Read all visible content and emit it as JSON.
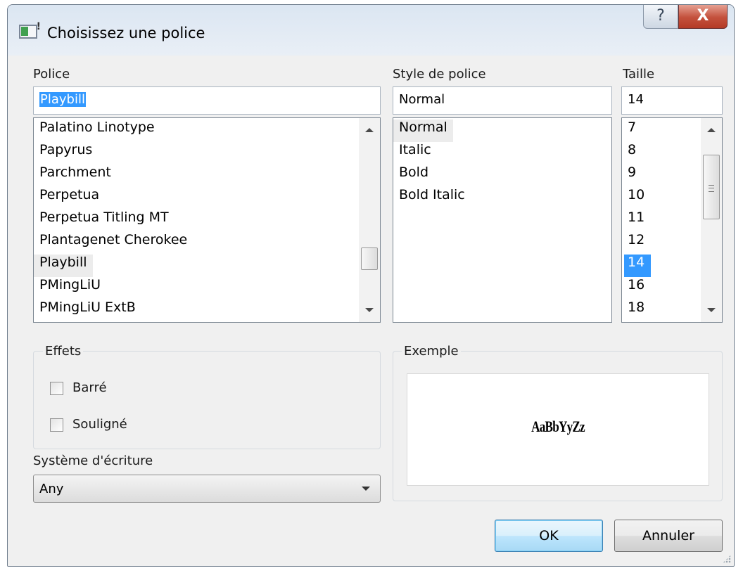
{
  "window": {
    "title": "Choisissez une police",
    "help_label": "?",
    "close_label": "X"
  },
  "font": {
    "label": "Police",
    "value": "Playbill",
    "items": [
      "Palatino Linotype",
      "Papyrus",
      "Parchment",
      "Perpetua",
      "Perpetua Titling MT",
      "Plantagenet Cherokee",
      "Playbill",
      "PMingLiU",
      "PMingLiU ExtB"
    ],
    "selected": "Playbill"
  },
  "style": {
    "label": "Style de police",
    "value": "Normal",
    "items": [
      "Normal",
      "Italic",
      "Bold",
      "Bold Italic"
    ],
    "selected": "Normal"
  },
  "size": {
    "label": "Taille",
    "value": "14",
    "items": [
      "7",
      "8",
      "9",
      "10",
      "11",
      "12",
      "14",
      "16",
      "18"
    ],
    "selected": "14"
  },
  "effects": {
    "label": "Effets",
    "strikeout_label": "Barré",
    "strikeout_checked": false,
    "underline_label": "Souligné",
    "underline_checked": false
  },
  "writing_system": {
    "label": "Système d'écriture",
    "value": "Any"
  },
  "sample": {
    "label": "Exemple",
    "text": "AaBbYyZz"
  },
  "buttons": {
    "ok": "OK",
    "cancel": "Annuler"
  },
  "colors": {
    "selection": "#3399ff",
    "close_button": "#c4513d",
    "default_button_border": "#3c7fb1"
  }
}
